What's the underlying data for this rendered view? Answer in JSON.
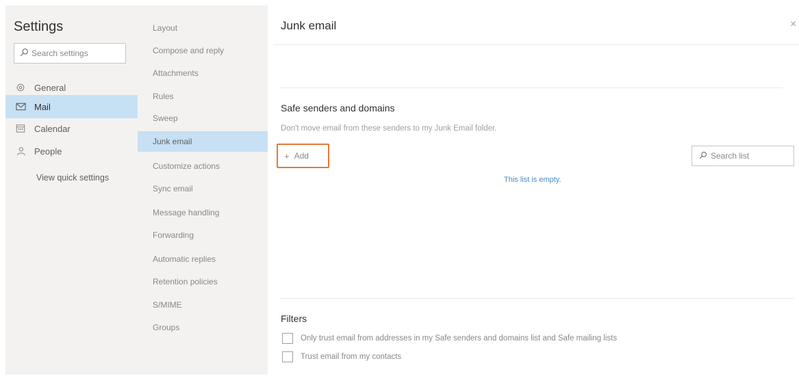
{
  "settings": {
    "title": "Settings",
    "search_placeholder": "Search settings",
    "nav": [
      {
        "label": "General",
        "icon": "gear-icon"
      },
      {
        "label": "Mail",
        "icon": "mail-icon"
      },
      {
        "label": "Calendar",
        "icon": "calendar-icon"
      },
      {
        "label": "People",
        "icon": "people-icon"
      }
    ],
    "quick_settings_link": "View quick settings"
  },
  "mail_submenu": [
    "Layout",
    "Compose and reply",
    "Attachments",
    "Rules",
    "Sweep",
    "Junk email",
    "Customize actions",
    "Sync email",
    "Message handling",
    "Forwarding",
    "Automatic replies",
    "Retention policies",
    "S/MIME",
    "Groups"
  ],
  "main": {
    "title": "Junk email",
    "close_glyph": "×",
    "safe_senders": {
      "heading": "Safe senders and domains",
      "description": "Don't move email from these senders to my Junk Email folder.",
      "add_label": "Add",
      "add_icon": "plus-icon",
      "search_placeholder": "Search list",
      "empty_text": "This list is empty."
    },
    "filters": {
      "heading": "Filters",
      "options": [
        {
          "label": "Only trust email from addresses in my Safe senders and domains list and Safe mailing lists",
          "checked": false
        },
        {
          "label": "Trust email from my contacts",
          "checked": false
        }
      ]
    }
  },
  "colors": {
    "selected_bg": "#c7e0f4",
    "pane_bg": "#f3f2f1",
    "highlight_border": "#e07b39",
    "link_blue": "#4a8bc2"
  }
}
